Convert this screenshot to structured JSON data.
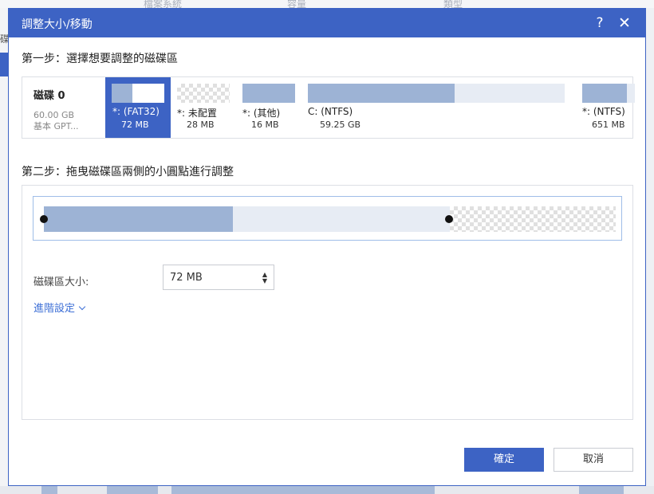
{
  "background": {
    "top_headers": [
      "檔案系統",
      "容量",
      "類型"
    ],
    "left_text": "碟"
  },
  "dialog": {
    "title": "調整大小/移動",
    "help_symbol": "?",
    "close_symbol": "✕"
  },
  "step1": {
    "label": "第一步：選擇想要調整的磁碟區"
  },
  "disk": {
    "name": "磁碟 0",
    "size": "60.00 GB",
    "type": "基本 GPT..."
  },
  "partitions": [
    {
      "label": "*: (FAT32)",
      "size": "72 MB",
      "selected": true,
      "used_fraction": 0.4
    },
    {
      "label": "*: 未配置",
      "size": "28 MB",
      "selected": false,
      "unallocated": true
    },
    {
      "label": "*: (其他)",
      "size": "16 MB",
      "selected": false,
      "used_fraction": 1.0
    },
    {
      "label": "C: (NTFS)",
      "size": "59.25 GB",
      "selected": false,
      "used_fraction": 0.57
    },
    {
      "label": "*: (NTFS)",
      "size": "651 MB",
      "selected": false,
      "used_fraction": 0.85
    }
  ],
  "step2": {
    "label": "第二步：拖曳磁碟區兩側的小圓點進行調整"
  },
  "resize": {
    "used_fraction": 0.33,
    "partition_fraction": 0.71,
    "size_label": "磁碟區大小:",
    "size_value": "72 MB",
    "advanced_label": "進階設定"
  },
  "buttons": {
    "ok": "確定",
    "cancel": "取消"
  },
  "colors": {
    "accent": "#3d63c4",
    "used": "#9db3d5",
    "free": "#e7ecf4",
    "link": "#3d6fd6"
  },
  "icons": {
    "help": "question-icon",
    "close": "close-icon",
    "advanced": "chevron-down-icon",
    "spinner_up": "triangle-up-icon",
    "spinner_down": "triangle-down-icon"
  }
}
